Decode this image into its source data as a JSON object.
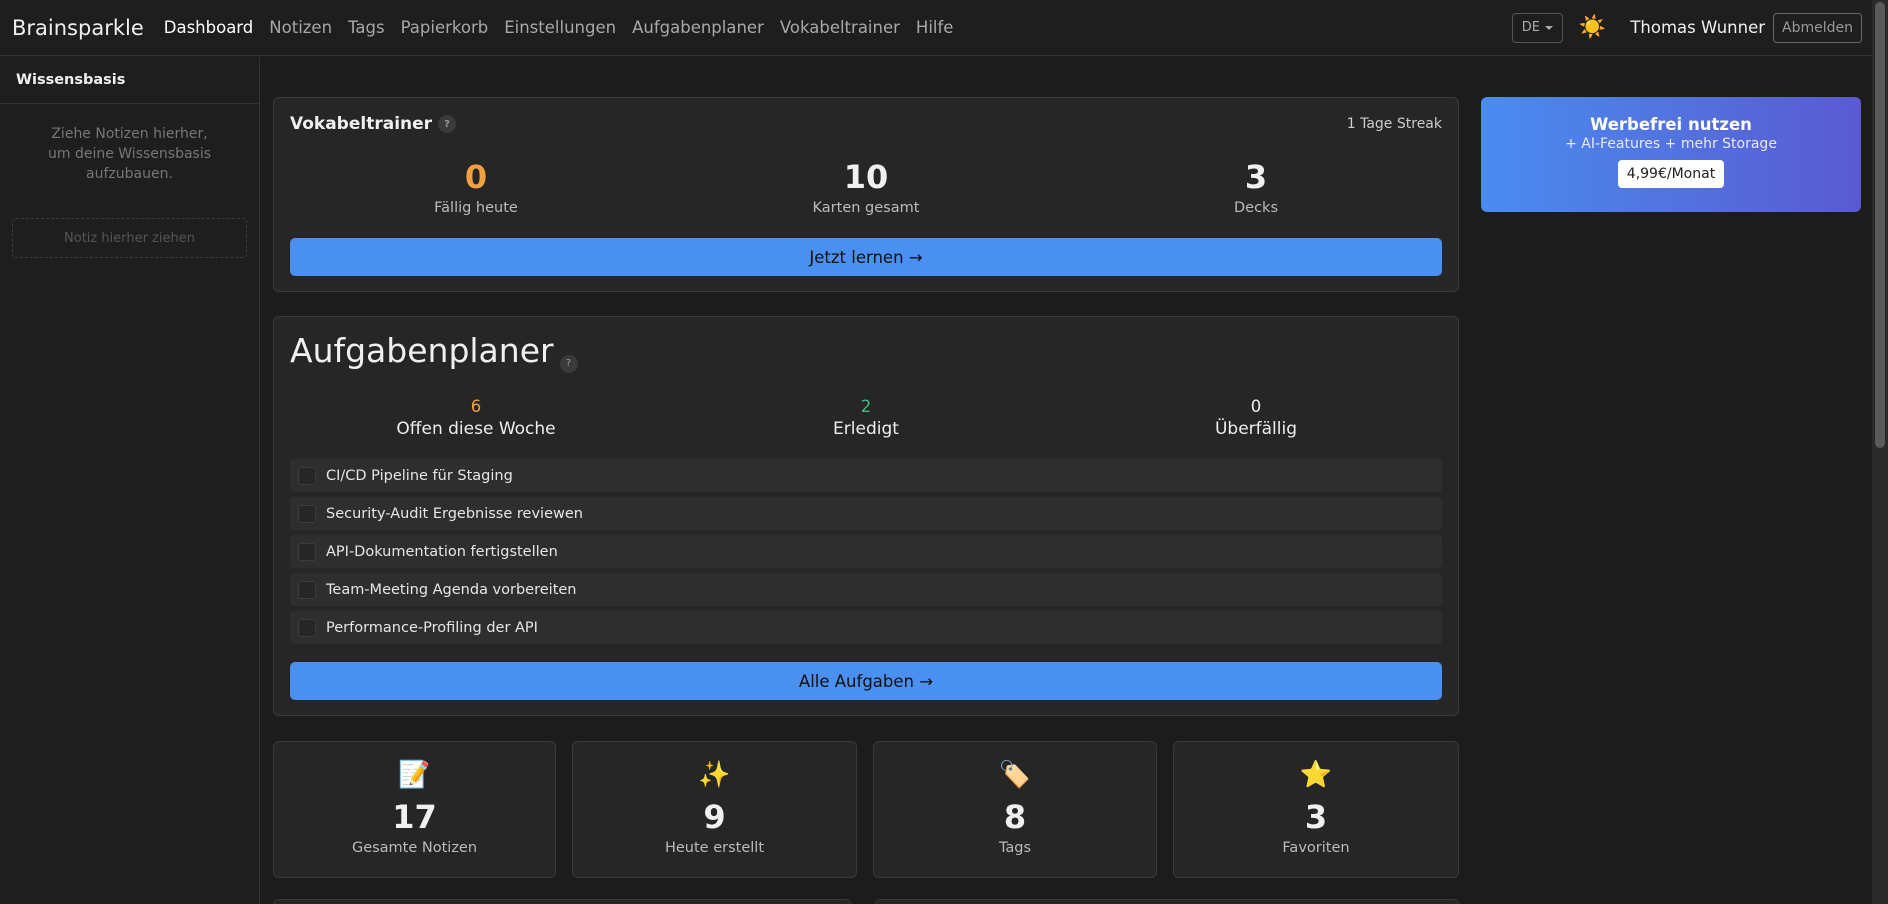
{
  "navbar": {
    "brand": "Brainsparkle",
    "links": [
      "Dashboard",
      "Notizen",
      "Tags",
      "Papierkorb",
      "Einstellungen",
      "Aufgabenplaner",
      "Vokabeltrainer",
      "Hilfe"
    ],
    "language": "DE",
    "username": "Thomas Wunner",
    "logout_label": "Abmelden"
  },
  "sidebar": {
    "title": "Wissensbasis",
    "empty_text": "Ziehe Notizen hierher, um deine Wissensbasis aufzubauen.",
    "dropzone_label": "Notiz hierher ziehen"
  },
  "vocab": {
    "title": "Vokabeltrainer",
    "help": "?",
    "streak": "1 Tage Streak",
    "stats": [
      {
        "value": "0",
        "label": "Fällig heute",
        "color": "#f0a040"
      },
      {
        "value": "10",
        "label": "Karten gesamt",
        "color": "#f0f0f0"
      },
      {
        "value": "3",
        "label": "Decks",
        "color": "#f0f0f0"
      }
    ],
    "button": "Jetzt lernen →"
  },
  "tasks": {
    "title": "Aufgabenplaner",
    "help": "?",
    "stats": [
      {
        "value": "6",
        "label": "Offen diese Woche",
        "color": "#f0a040"
      },
      {
        "value": "2",
        "label": "Erledigt",
        "color": "#3cc080"
      },
      {
        "value": "0",
        "label": "Überfällig",
        "color": "#f0f0f0"
      }
    ],
    "items": [
      "CI/CD Pipeline für Staging",
      "Security-Audit Ergebnisse reviewen",
      "API-Dokumentation fertigstellen",
      "Team-Meeting Agenda vorbereiten",
      "Performance-Profiling der API"
    ],
    "button": "Alle Aufgaben →"
  },
  "summary": [
    {
      "icon": "memo-icon",
      "glyph": "📝",
      "value": "17",
      "label": "Gesamte Notizen"
    },
    {
      "icon": "sparkles-icon",
      "glyph": "✨",
      "value": "9",
      "label": "Heute erstellt"
    },
    {
      "icon": "tag-icon",
      "glyph": "🏷️",
      "value": "8",
      "label": "Tags"
    },
    {
      "icon": "star-icon",
      "glyph": "⭐",
      "value": "3",
      "label": "Favoriten"
    }
  ],
  "promo": {
    "title": "Werbefrei nutzen",
    "subtitle": "+ AI-Features + mehr Storage",
    "price": "4,99€/Monat"
  }
}
